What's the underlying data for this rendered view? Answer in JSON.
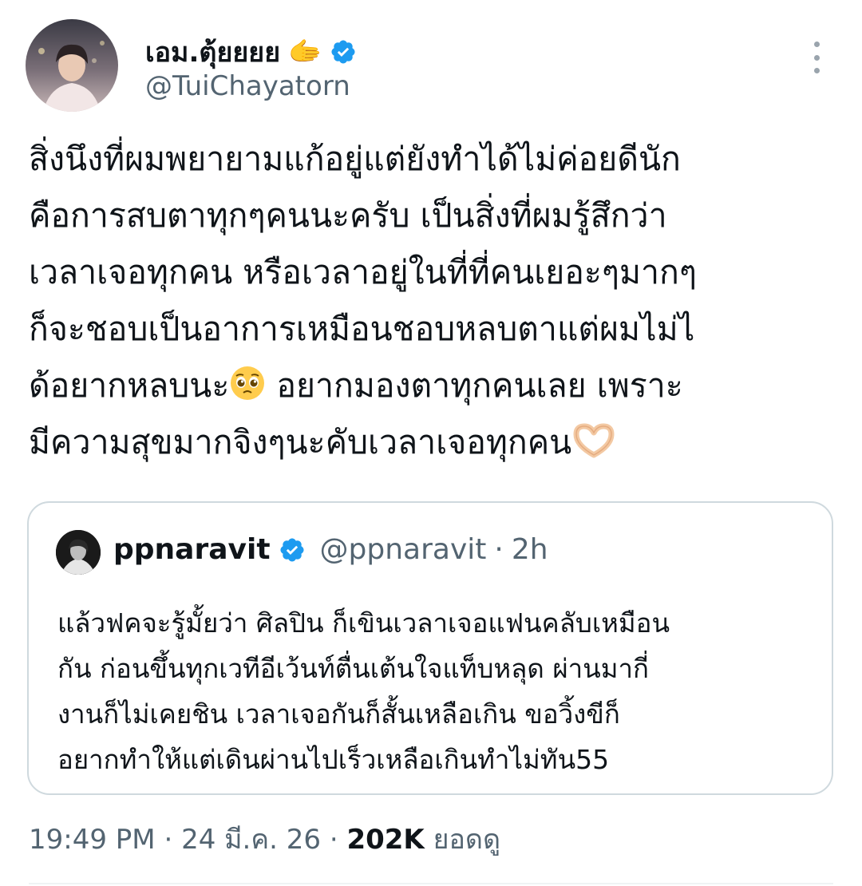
{
  "author": {
    "display_name": "เอม.ตุ้ยยยย",
    "name_emoji": "🫱",
    "handle": "@TuiChayatorn",
    "verified": true
  },
  "tweet": {
    "lines": [
      "สิ่งนึงที่ผมพยายามแก้อยู่แต่ยังทำได้ไม่ค่อยดีนัก",
      "คือการสบตาทุกๆคนนะครับ เป็นสิ่งที่ผมรู้สึกว่า",
      "เวลาเจอทุกคน หรือเวลาอยู่ในที่ที่คนเยอะๆมากๆ",
      "ก็จะชอบเป็นอาการเหมือนชอบหลบตาแต่ผมไม่ไ",
      "ด้อยากหลบนะ",
      " อยากมองตาทุกคนเลย เพราะ",
      "มีความสุขมากจิงๆนะคับเวลาเจอทุกคน"
    ]
  },
  "quote": {
    "name": "ppnaravit",
    "handle": "@ppnaravit",
    "separator": "·",
    "time": "2h",
    "text": "แล้วฟคจะรู้มั้ยว่า ศิลปิน ก็เขินเวลาเจอแฟนคลับเหมือน\nกัน ก่อนขึ้นทุกเวทีอีเว้นท์ตื่นเต้นใจแท็บหลุด ผ่านมากี่\nงานก็ไม่เคยชิน เวลาเจอกันก็สั้นเหลือเกิน ขอวิ้งขีก็\nอยากทำให้แต่เดินผ่านไปเร็วเหลือเกินทำไม่ทัน55"
  },
  "meta": {
    "time": "19:49 PM",
    "sep1": "·",
    "date": "24 มี.ค. 26",
    "sep2": "·",
    "views": "202K",
    "views_label": "ยอดดู"
  },
  "colors": {
    "verified_blue": "#1d9bf0",
    "secondary_text": "#536471",
    "border": "#cfd9de"
  }
}
